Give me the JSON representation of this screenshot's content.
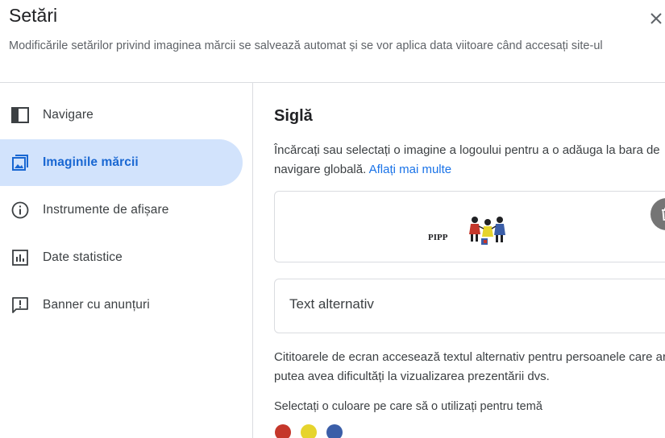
{
  "header": {
    "title": "Setări",
    "subtitle": "Modificările setărilor privind imaginea mărcii se salvează automat și se vor aplica data viitoare când accesați site-ul",
    "close_icon": "close-icon"
  },
  "sidebar": {
    "items": [
      {
        "label": "Navigare",
        "icon": "navigation-panel-icon",
        "active": false
      },
      {
        "label": "Imaginile mărcii",
        "icon": "image-icon",
        "active": true
      },
      {
        "label": "Instrumente de afișare",
        "icon": "info-icon",
        "active": false
      },
      {
        "label": "Date statistice",
        "icon": "bar-chart-icon",
        "active": false
      },
      {
        "label": "Banner cu anunțuri",
        "icon": "announcement-icon",
        "active": false
      }
    ]
  },
  "main": {
    "section_title": "Siglă",
    "description": "Încărcați sau selectați o imagine a logoului pentru a o adăuga la bara de navigare globală.",
    "learn_more": "Aflați mai multe",
    "logo_text": "PIPP",
    "delete_icon": "trash-icon",
    "alt_text_placeholder": "Text alternativ",
    "alt_help": "Cititoarele de ecran accesează textul alternativ pentru persoanele care ar putea avea dificultăți la vizualizarea prezentării dvs.",
    "color_label": "Selectați o culoare pe care să o utilizați pentru temă",
    "colors": [
      "#c5372b",
      "#e6d42d",
      "#3b5ea8"
    ]
  }
}
